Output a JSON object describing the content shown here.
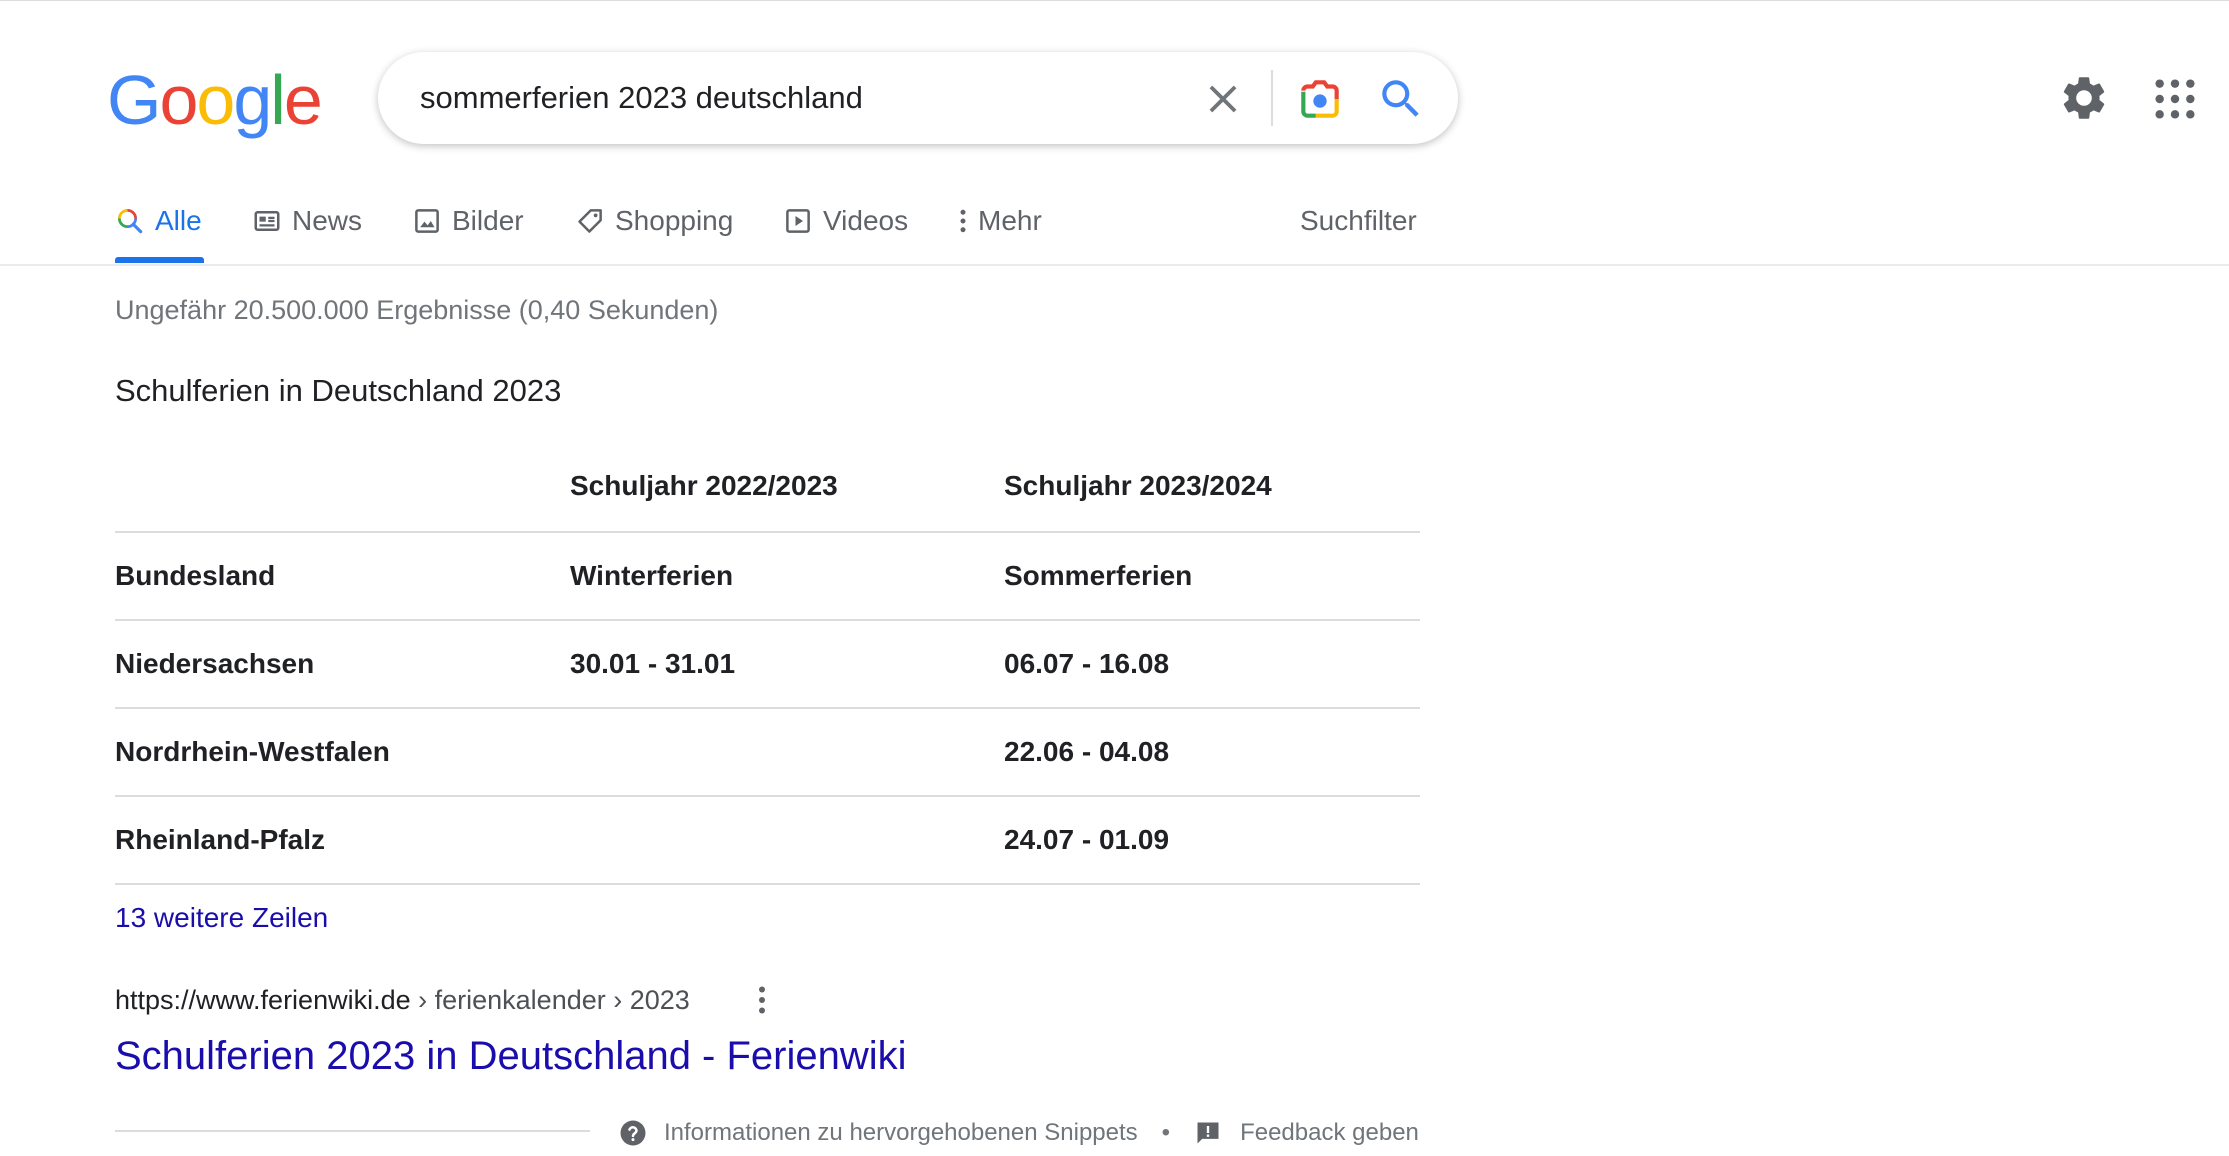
{
  "header": {
    "logo_letters": [
      {
        "ch": "G",
        "color": "#4285F4"
      },
      {
        "ch": "o",
        "color": "#EA4335"
      },
      {
        "ch": "o",
        "color": "#FBBC05"
      },
      {
        "ch": "g",
        "color": "#4285F4"
      },
      {
        "ch": "l",
        "color": "#34A853"
      },
      {
        "ch": "e",
        "color": "#EA4335"
      }
    ],
    "search": {
      "value": "sommerferien 2023 deutschland"
    },
    "icons": {
      "clear": "close-icon",
      "lens": "camera-lens-icon",
      "search": "search-icon",
      "settings": "gear-icon",
      "apps": "apps-grid-icon"
    }
  },
  "tabs": {
    "items": [
      {
        "label": "Alle",
        "icon": "search-icon",
        "active": true
      },
      {
        "label": "News",
        "icon": "newspaper-icon"
      },
      {
        "label": "Bilder",
        "icon": "image-icon"
      },
      {
        "label": "Shopping",
        "icon": "tag-icon"
      },
      {
        "label": "Videos",
        "icon": "play-icon"
      },
      {
        "label": "Mehr",
        "icon": "more-vertical-icon"
      }
    ],
    "tools_label": "Suchfilter"
  },
  "results": {
    "stats": "Ungefähr 20.500.000 Ergebnisse (0,40 Sekunden)",
    "snippet": {
      "title": "Schulferien in Deutschland 2023",
      "table": {
        "header": [
          "",
          "Schuljahr 2022/2023",
          "Schuljahr 2023/2024"
        ],
        "rows": [
          [
            "Bundesland",
            "Winterferien",
            "Sommerferien"
          ],
          [
            "Niedersachsen",
            "30.01 - 31.01",
            "06.07 - 16.08"
          ],
          [
            "Nordrhein-Westfalen",
            "",
            "22.06 - 04.08"
          ],
          [
            "Rheinland-Pfalz",
            "",
            "24.07 - 01.09"
          ]
        ]
      },
      "more_rows_link": "13 weitere Zeilen",
      "source": {
        "domain": "https://www.ferienwiki.de",
        "breadcrumbs": " › ferienkalender › 2023",
        "title": "Schulferien 2023 in Deutschland - Ferienwiki"
      },
      "footer": {
        "about_label": "Informationen zu hervorgehobenen Snippets",
        "separator": "•",
        "feedback_label": "Feedback geben"
      }
    }
  },
  "colors": {
    "accent": "#1a73e8",
    "link": "#1a0dab",
    "text": "#202124",
    "muted": "#70757a"
  }
}
